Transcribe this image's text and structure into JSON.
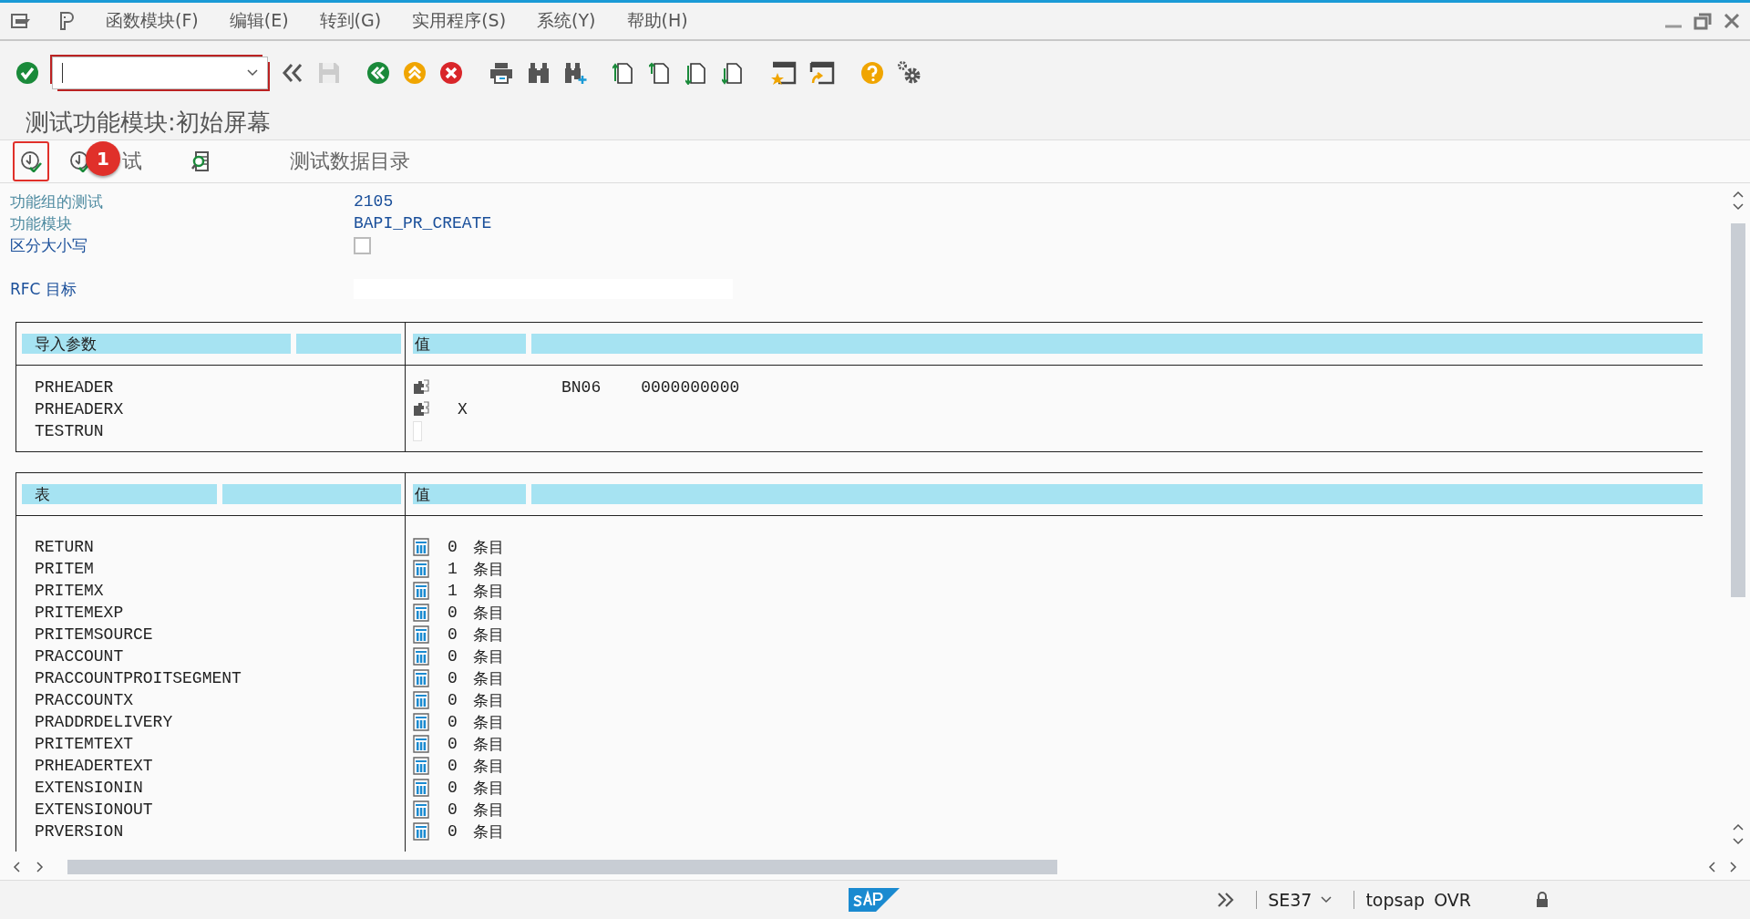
{
  "menu_bar": {
    "items": [
      "函数模块(F)",
      "编辑(E)",
      "转到(G)",
      "实用程序(S)",
      "系统(Y)",
      "帮助(H)"
    ]
  },
  "title": "测试功能模块:初始屏幕",
  "app_toolbar": {
    "buttons": [
      {
        "kind": "icon",
        "highlighted": true
      },
      {
        "kind": "icon-label",
        "label": "试",
        "highlighted": false
      },
      {
        "kind": "icon",
        "highlighted": false
      },
      {
        "kind": "label",
        "label": "测试数据目录",
        "highlighted": false
      }
    ]
  },
  "annotation": {
    "label": "1"
  },
  "fields": [
    {
      "kind": "display",
      "label": "功能组的测试",
      "value": "2105"
    },
    {
      "kind": "display",
      "label": "功能模块",
      "value": "BAPI_PR_CREATE"
    },
    {
      "kind": "checkbox",
      "label": "区分大小写",
      "checked": false
    },
    {
      "kind": "input",
      "label": "RFC 目标"
    }
  ],
  "import_parameters": {
    "columns": [
      "导入参数",
      "值"
    ],
    "rows": [
      {
        "kind": "structure",
        "name": "PRHEADER",
        "values": [
          "BN06",
          "0000000000"
        ]
      },
      {
        "kind": "structure",
        "name": "PRHEADERX",
        "values": [
          "X"
        ]
      },
      {
        "kind": "field",
        "name": "TESTRUN"
      }
    ]
  },
  "tables": {
    "columns": [
      "表",
      "值"
    ],
    "rows": [
      {
        "name": "RETURN",
        "count": "0",
        "unit": "条目"
      },
      {
        "name": "PRITEM",
        "count": "1",
        "unit": "条目"
      },
      {
        "name": "PRITEMX",
        "count": "1",
        "unit": "条目"
      },
      {
        "name": "PRITEMEXP",
        "count": "0",
        "unit": "条目"
      },
      {
        "name": "PRITEMSOURCE",
        "count": "0",
        "unit": "条目"
      },
      {
        "name": "PRACCOUNT",
        "count": "0",
        "unit": "条目"
      },
      {
        "name": "PRACCOUNTPROITSEGMENT",
        "count": "0",
        "unit": "条目"
      },
      {
        "name": "PRACCOUNTX",
        "count": "0",
        "unit": "条目"
      },
      {
        "name": "PRADDRDELIVERY",
        "count": "0",
        "unit": "条目"
      },
      {
        "name": "PRITEMTEXT",
        "count": "0",
        "unit": "条目"
      },
      {
        "name": "PRHEADERTEXT",
        "count": "0",
        "unit": "条目"
      },
      {
        "name": "EXTENSIONIN",
        "count": "0",
        "unit": "条目"
      },
      {
        "name": "EXTENSIONOUT",
        "count": "0",
        "unit": "条目"
      },
      {
        "name": "PRVERSION",
        "count": "0",
        "unit": "条目"
      }
    ]
  },
  "status_bar": {
    "transaction": "SE37",
    "user": "topsap",
    "mode": "OVR"
  }
}
